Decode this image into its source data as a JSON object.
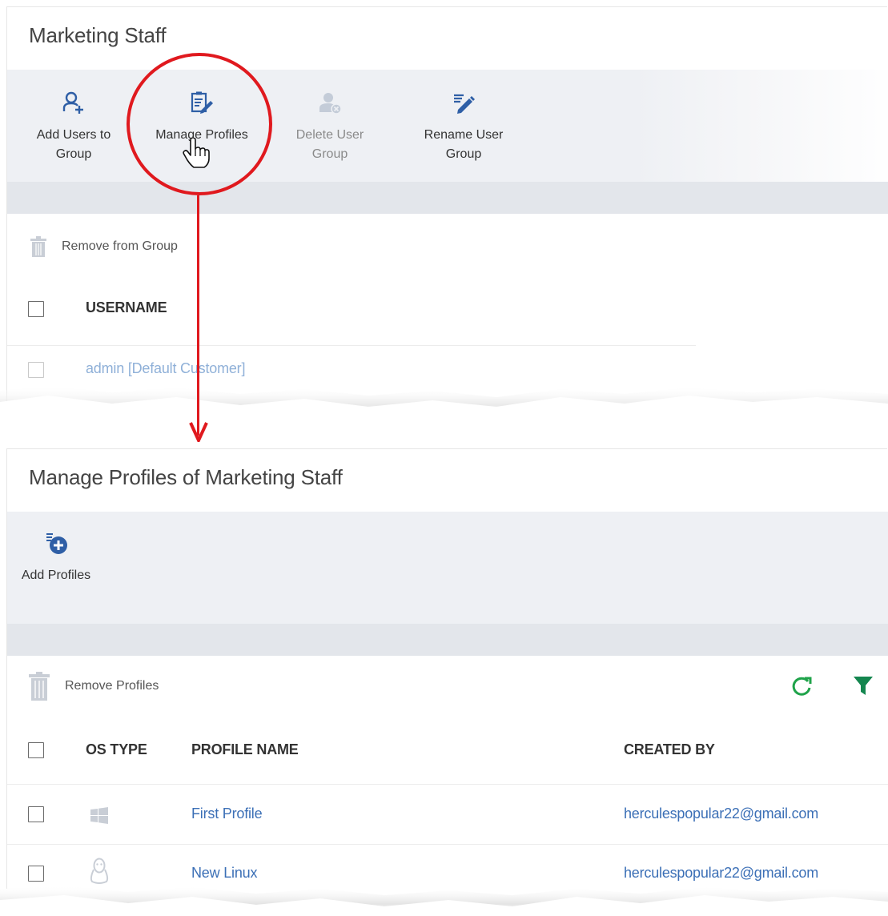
{
  "top_panel": {
    "title": "Marketing Staff",
    "toolbar": [
      {
        "label_line1": "Add Users to",
        "label_line2": "Group",
        "icon": "add-user-icon",
        "enabled": true
      },
      {
        "label_line1": "Manage Profiles",
        "label_line2": "",
        "icon": "manage-profiles-icon",
        "enabled": true
      },
      {
        "label_line1": "Delete User",
        "label_line2": "Group",
        "icon": "delete-group-icon",
        "enabled": false
      },
      {
        "label_line1": "Rename User",
        "label_line2": "Group",
        "icon": "rename-icon",
        "enabled": true
      }
    ],
    "remove_action": "Remove from Group",
    "column_username": "USERNAME",
    "rows": [
      {
        "username": "admin [Default Customer]"
      }
    ]
  },
  "bottom_panel": {
    "title": "Manage Profiles of Marketing Staff",
    "toolbar": [
      {
        "label": "Add Profiles",
        "icon": "add-profile-icon"
      }
    ],
    "remove_action": "Remove Profiles",
    "refresh_icon": "refresh-icon",
    "filter_icon": "filter-icon",
    "columns": {
      "os_type": "OS TYPE",
      "profile_name": "PROFILE NAME",
      "created_by": "CREATED BY"
    },
    "rows": [
      {
        "os": "windows-icon",
        "profile_name": "First Profile",
        "created_by": "herculespopular22@gmail.com"
      },
      {
        "os": "linux-icon",
        "profile_name": "New Linux",
        "created_by": "herculespopular22@gmail.com"
      }
    ]
  },
  "colors": {
    "accent": "#3b6fb6",
    "annotation": "#e0191e",
    "refresh": "#1fa34a",
    "filter": "#14864f",
    "toolbar_bg": "#eef0f4"
  }
}
